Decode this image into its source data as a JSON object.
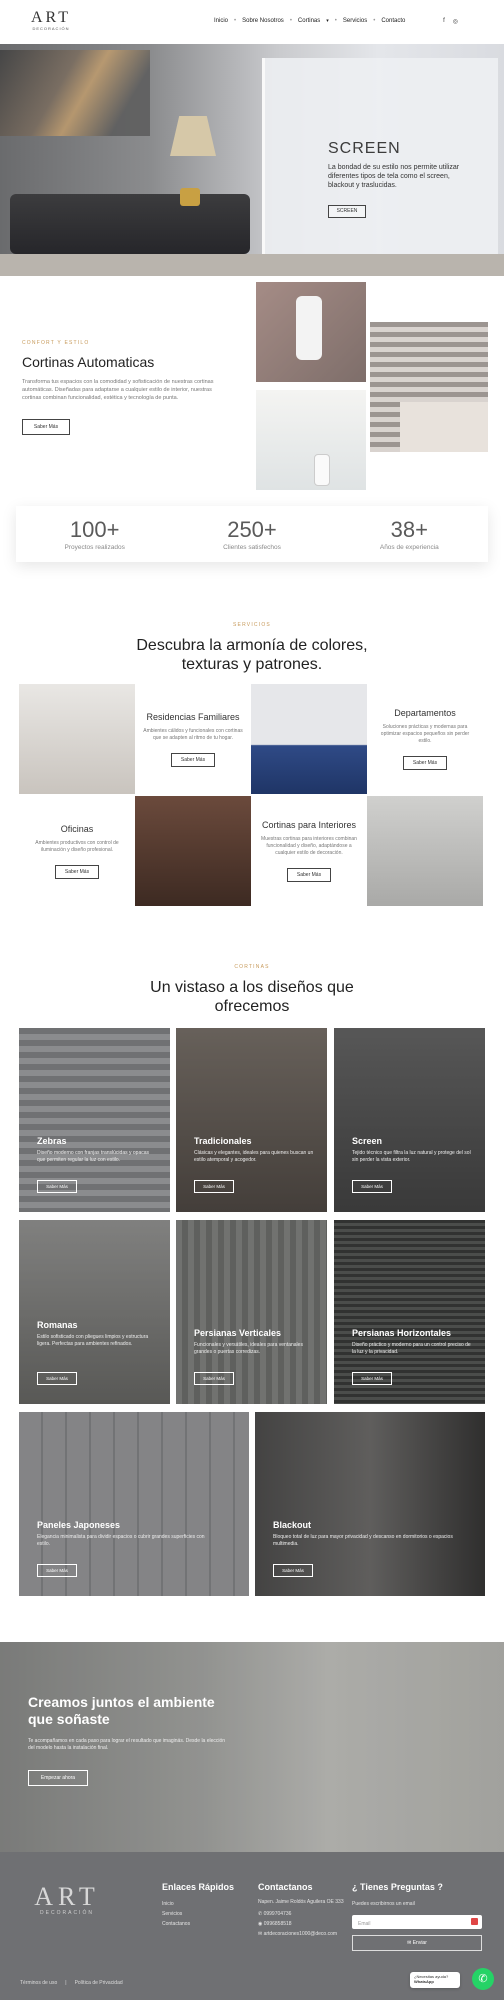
{
  "header": {
    "logo_main": "ART",
    "logo_sub": "DECORACIÓN",
    "nav": [
      "Inicio",
      "Sobre Nosotros",
      "Cortinas",
      "Servicios",
      "Contacto"
    ],
    "social_icons": [
      "facebook-icon",
      "instagram-icon"
    ]
  },
  "hero": {
    "title": "SCREEN",
    "text": "La bondad de su estilo nos permite utilizar diferentes tipos de tela como el screen, blackout y traslucidas.",
    "button": "SCREEN"
  },
  "automaticas": {
    "eyebrow": "CONFORT Y ESTILO",
    "title": "Cortinas Automaticas",
    "text": "Transforma tus espacios con la comodidad y sofisticación de nuestras cortinas automáticas. Diseñadas para adaptarse a cualquier estilo de interior, nuestras cortinas combinan funcionalidad, estética y tecnología de punta.",
    "button": "Saber Más"
  },
  "stats": [
    {
      "number": "100+",
      "label": "Proyectos realizados"
    },
    {
      "number": "250+",
      "label": "Clientes satisfechos"
    },
    {
      "number": "38+",
      "label": "Años de experiencia"
    }
  ],
  "services": {
    "eyebrow": "SERVICIOS",
    "title": "Descubra la armonía de colores, texturas y patrones.",
    "items": [
      {
        "title": "Residencias Familiares",
        "text": "Ambientes cálidos y funcionales con cortinas que se adapten al ritmo de tu hogar.",
        "button": "Saber Más"
      },
      {
        "title": "Departamentos",
        "text": "Soluciones prácticas y modernas para optimizar espacios pequeños sin perder estilo.",
        "button": "Saber Más"
      },
      {
        "title": "Oficinas",
        "text": "Ambientes productivos con control de iluminación y diseño profesional.",
        "button": "Saber Más"
      },
      {
        "title": "Cortinas para Interiores",
        "text": "Muestras cortinas para interiores combinan funcionalidad y diseño, adaptándose a cualquier estilo de decoración.",
        "button": "Saber Más"
      }
    ]
  },
  "gallery": {
    "eyebrow": "CORTINAS",
    "title": "Un vistaso a los diseños que ofrecemos",
    "cards": [
      {
        "title": "Zebras",
        "text": "Diseño moderno con franjas translúcidas y opacas que permiten regular la luz con estilo.",
        "button": "Saber Más"
      },
      {
        "title": "Tradicionales",
        "text": "Clásicas y elegantes, ideales para quienes buscan un estilo atemporal y acogedor.",
        "button": "Saber Más"
      },
      {
        "title": "Screen",
        "text": "Tejido técnico que filtra la luz natural y protege del sol sin perder la vista exterior.",
        "button": "Saber Más"
      },
      {
        "title": "Romanas",
        "text": "Estilo sofisticado con pliegues limpios y estructura ligera. Perfectas para ambientes refinados.",
        "button": "Saber Más"
      },
      {
        "title": "Persianas Verticales",
        "text": "Funcionales y versátiles, ideales para ventanales grandes o puertas corredizas.",
        "button": "Saber Más"
      },
      {
        "title": "Persianas Horizontales",
        "text": "Diseño práctico y moderno para un control preciso de la luz y la privacidad.",
        "button": "Saber Más"
      },
      {
        "title": "Paneles Japoneses",
        "text": "Elegancia minimalista para dividir espacios o cubrir grandes superficies con estilo.",
        "button": "Saber Más"
      },
      {
        "title": "Blackout",
        "text": "Bloqueo total de luz para mayor privacidad y descanso en dormitorios o espacios multimedia.",
        "button": "Saber Más"
      }
    ]
  },
  "cta": {
    "title": "Creamos juntos el ambiente que soñaste",
    "text": "Te acompañamos en cada paso para lograr el resultado que imaginás. Desde la elección del modelo hasta la instalación final.",
    "button": "Empezar ahora"
  },
  "footer": {
    "logo_main": "ART",
    "logo_sub": "DECORACIÓN",
    "links_title": "Enlaces Rápidos",
    "links": [
      "Inicio",
      "Servicios",
      "Contactanos"
    ],
    "contact_title": "Contactanos",
    "address": "Napen. Jaime Roldós Aguilera OE 333",
    "phone1": "0999704736",
    "phone2": "0996858518",
    "email": "artdecoraciones1000@deco.com",
    "question_title": "¿ Tienes Preguntas ?",
    "question_text": "Puedes escribirnos un email",
    "email_placeholder": "Email",
    "send": "Enviar",
    "terms": "Términos de uso",
    "privacy": "Política de Privacidad"
  },
  "whatsapp": {
    "bubble_line1": "¿Necesitas ayuda?",
    "bubble_line2": "WhatsApp"
  }
}
